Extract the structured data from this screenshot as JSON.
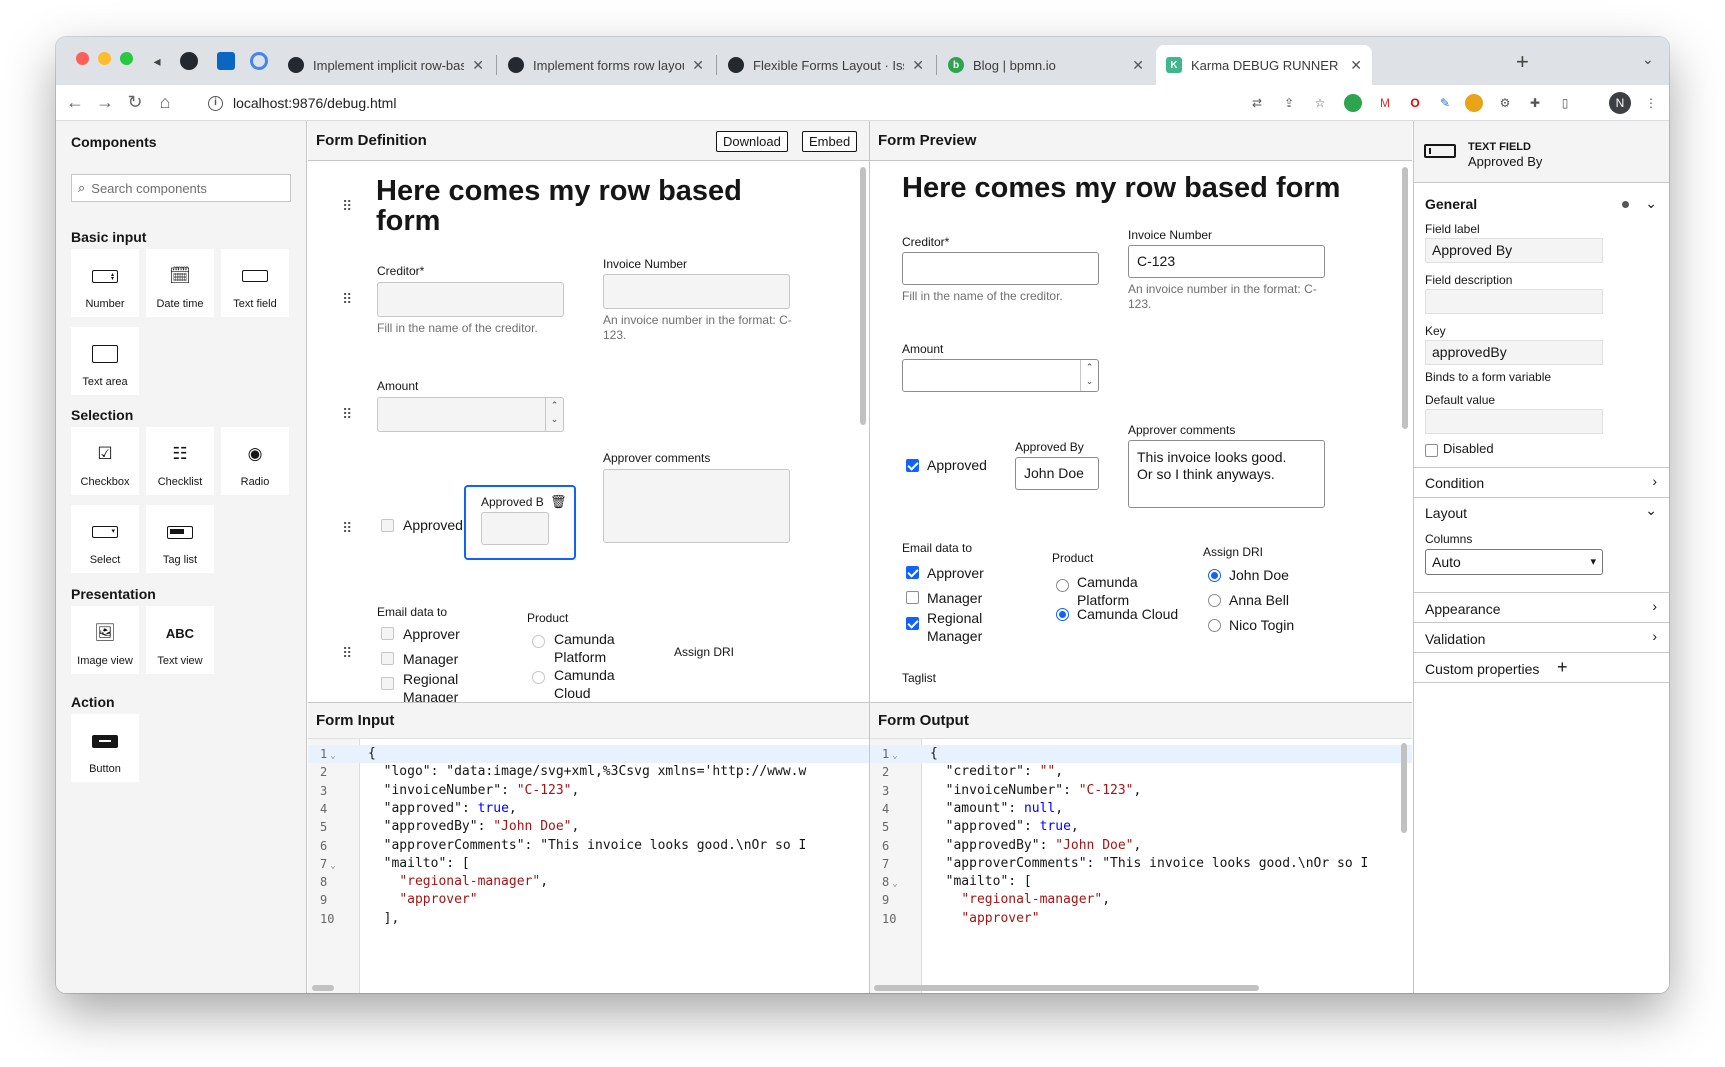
{
  "browser": {
    "tabs": [
      {
        "title": "Implement implicit row-based l",
        "favicon_color": "#24292f"
      },
      {
        "title": "Implement forms row layout by",
        "favicon_color": "#24292f"
      },
      {
        "title": "Flexible Forms Layout · Issue #",
        "favicon_color": "#24292f"
      },
      {
        "title": "Blog | bpmn.io",
        "favicon_color": "#2ea44f"
      },
      {
        "title": "Karma DEBUG RUNNER",
        "favicon_color": "#3fb68b"
      }
    ],
    "url": "localhost:9876/debug.html",
    "profile_initial": "N"
  },
  "palette": {
    "title": "Components",
    "search_placeholder": "Search components",
    "groups": [
      {
        "name": "Basic input",
        "items": [
          "Number",
          "Date time",
          "Text field",
          "Text area"
        ]
      },
      {
        "name": "Selection",
        "items": [
          "Checkbox",
          "Checklist",
          "Radio",
          "Select",
          "Tag list"
        ]
      },
      {
        "name": "Presentation",
        "items": [
          "Image view",
          "Text view"
        ]
      },
      {
        "name": "Action",
        "items": [
          "Button"
        ]
      }
    ]
  },
  "definition": {
    "title": "Form Definition",
    "download": "Download",
    "embed": "Embed",
    "form_title": "Here comes my row based form",
    "creditor_label": "Creditor*",
    "creditor_desc": "Fill in the name of the creditor.",
    "invoice_label": "Invoice Number",
    "invoice_desc": "An invoice number in the format: C-123.",
    "amount_label": "Amount",
    "approved_label": "Approved",
    "approved_by_label": "Approved B",
    "comments_label": "Approver comments",
    "email_label": "Email data to",
    "email_options": [
      "Approver",
      "Manager",
      "Regional Manager"
    ],
    "product_label": "Product",
    "product_options": [
      "Camunda Platform",
      "Camunda Cloud"
    ],
    "dri_label": "Assign DRI"
  },
  "preview": {
    "title": "Form Preview",
    "form_title": "Here comes my row based form",
    "creditor_label": "Creditor*",
    "creditor_value": "",
    "creditor_desc": "Fill in the name of the creditor.",
    "invoice_label": "Invoice Number",
    "invoice_value": "C-123",
    "invoice_desc": "An invoice number in the format: C-123.",
    "amount_label": "Amount",
    "approved_label": "Approved",
    "approved_checked": true,
    "approved_by_label": "Approved By",
    "approved_by_value": "John Doe",
    "comments_label": "Approver comments",
    "comments_line1": "This invoice looks good.",
    "comments_line2": "Or so I think anyways.",
    "email_label": "Email data to",
    "email_options": [
      {
        "label": "Approver",
        "checked": true
      },
      {
        "label": "Manager",
        "checked": false
      },
      {
        "label": "Regional Manager",
        "checked": true
      }
    ],
    "product_label": "Product",
    "product_options": [
      {
        "label": "Camunda Platform",
        "selected": false
      },
      {
        "label": "Camunda Cloud",
        "selected": true
      }
    ],
    "dri_label": "Assign DRI",
    "dri_options": [
      {
        "label": "John Doe",
        "selected": true
      },
      {
        "label": "Anna Bell",
        "selected": false
      },
      {
        "label": "Nico Togin",
        "selected": false
      }
    ],
    "taglist_label": "Taglist"
  },
  "input": {
    "title": "Form Input",
    "lines": [
      {
        "n": "1",
        "fold": true,
        "text": "{"
      },
      {
        "n": "2",
        "text": "  \"logo\": \"data:image/svg+xml,%3Csvg xmlns='http://www.w"
      },
      {
        "n": "3",
        "text": "  \"invoiceNumber\": \"C-123\","
      },
      {
        "n": "4",
        "text": "  \"approved\": true,"
      },
      {
        "n": "5",
        "text": "  \"approvedBy\": \"John Doe\","
      },
      {
        "n": "6",
        "text": "  \"approverComments\": \"This invoice looks good.\\nOr so I"
      },
      {
        "n": "7",
        "fold": true,
        "text": "  \"mailto\": ["
      },
      {
        "n": "8",
        "text": "    \"regional-manager\","
      },
      {
        "n": "9",
        "text": "    \"approver\""
      },
      {
        "n": "10",
        "text": "  ],"
      }
    ]
  },
  "output": {
    "title": "Form Output",
    "lines": [
      {
        "n": "1",
        "fold": true,
        "text": "{"
      },
      {
        "n": "2",
        "text": "  \"creditor\": \"\","
      },
      {
        "n": "3",
        "text": "  \"invoiceNumber\": \"C-123\","
      },
      {
        "n": "4",
        "text": "  \"amount\": null,"
      },
      {
        "n": "5",
        "text": "  \"approved\": true,"
      },
      {
        "n": "6",
        "text": "  \"approvedBy\": \"John Doe\","
      },
      {
        "n": "7",
        "text": "  \"approverComments\": \"This invoice looks good.\\nOr so I"
      },
      {
        "n": "8",
        "fold": true,
        "text": "  \"mailto\": ["
      },
      {
        "n": "9",
        "text": "    \"regional-manager\","
      },
      {
        "n": "10",
        "text": "    \"approver\""
      }
    ]
  },
  "properties": {
    "type": "TEXT FIELD",
    "name": "Approved By",
    "general": "General",
    "field_label": "Field label",
    "field_label_value": "Approved By",
    "field_description": "Field description",
    "field_description_value": "",
    "key": "Key",
    "key_value": "approvedBy",
    "key_desc": "Binds to a form variable",
    "default_value": "Default value",
    "default_value_value": "",
    "disabled": "Disabled",
    "condition": "Condition",
    "layout": "Layout",
    "columns": "Columns",
    "columns_value": "Auto",
    "appearance": "Appearance",
    "validation": "Validation",
    "custom_properties": "Custom properties"
  },
  "colors": {
    "accent": "#0f62fe",
    "selection_outline": "#0f62fe",
    "string": "#a31515",
    "keyword": "#0000ff"
  }
}
